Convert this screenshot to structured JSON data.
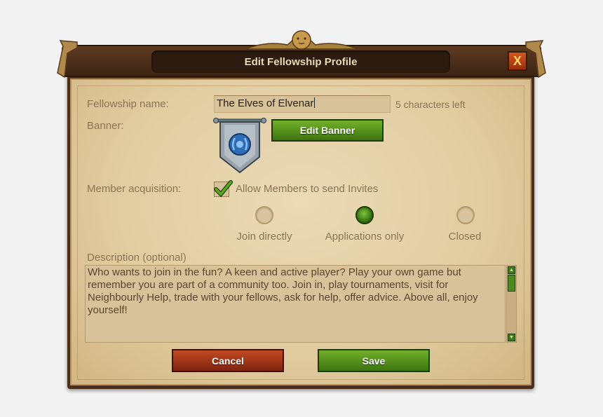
{
  "dialog": {
    "title": "Edit Fellowship Profile",
    "close_label": "X"
  },
  "form": {
    "name_label": "Fellowship name:",
    "name_value": "The Elves of Elvenar",
    "chars_left": "5 characters left",
    "banner_label": "Banner:",
    "edit_banner_label": "Edit Banner",
    "acquisition_label": "Member acquisition:",
    "allow_invites_label": "Allow Members to send Invites",
    "allow_invites_checked": true,
    "acquisition_options": [
      "Join directly",
      "Applications only",
      "Closed"
    ],
    "acquisition_selected": "Applications only",
    "description_label": "Description (optional)",
    "description_text": "Who wants to join in the fun? A keen and active player? Play your own game but remember you are part of a community too. Join in, play tournaments, visit for Neighbourly Help, trade with your fellows, ask for help, offer advice. Above all, enjoy yourself!"
  },
  "actions": {
    "cancel_label": "Cancel",
    "save_label": "Save"
  },
  "icons": {
    "banner": "laurel-wreath-banner-icon",
    "crest": "lion-crest-icon",
    "check": "checkmark-icon"
  },
  "colors": {
    "accent_green": "#5a9a1f",
    "cancel_red": "#a63a18",
    "parchment": "#e2cda2",
    "wood": "#4a2f1c"
  }
}
